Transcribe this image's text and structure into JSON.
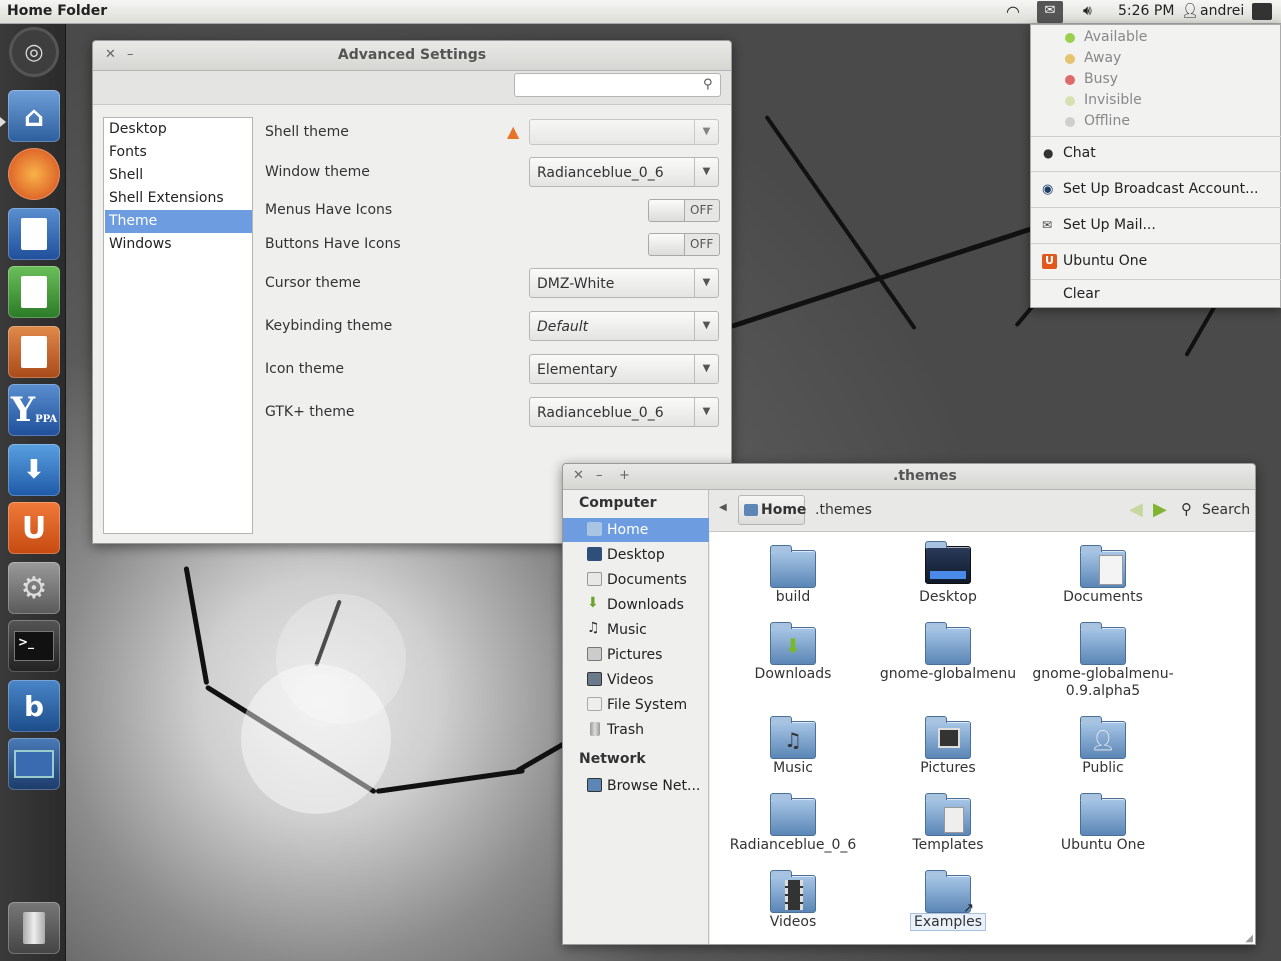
{
  "top_panel": {
    "title": "Home Folder",
    "time": "5:26 PM",
    "user": "andrei"
  },
  "message_menu": {
    "statuses": [
      {
        "label": "Available",
        "color": "#9ccf4e"
      },
      {
        "label": "Away",
        "color": "#e6c36e"
      },
      {
        "label": "Busy",
        "color": "#e06a6a"
      },
      {
        "label": "Invisible",
        "color": "#d6e0b0"
      },
      {
        "label": "Offline",
        "color": "#cfcfcf"
      }
    ],
    "chat": "Chat",
    "broadcast": "Set Up Broadcast Account...",
    "mail": "Set Up Mail...",
    "ubuntu_one": "Ubuntu One",
    "clear": "Clear"
  },
  "advanced_settings": {
    "title": "Advanced Settings",
    "search_placeholder": "",
    "categories": [
      "Desktop",
      "Fonts",
      "Shell",
      "Shell Extensions",
      "Theme",
      "Windows"
    ],
    "selected_category": "Theme",
    "rows": [
      {
        "label": "Shell theme",
        "value": ""
      },
      {
        "label": "Window theme",
        "value": "Radianceblue_0_6"
      },
      {
        "label": "Menus Have Icons",
        "toggle": "OFF"
      },
      {
        "label": "Buttons Have Icons",
        "toggle": "OFF"
      },
      {
        "label": "Cursor theme",
        "value": "DMZ-White"
      },
      {
        "label": "Keybinding theme",
        "value": "Default"
      },
      {
        "label": "Icon theme",
        "value": "Elementary"
      },
      {
        "label": "GTK+ theme",
        "value": "Radianceblue_0_6"
      }
    ]
  },
  "file_manager": {
    "title": ".themes",
    "path": [
      "Home",
      ".themes"
    ],
    "search_label": "Search",
    "sidebar": {
      "computer_header": "Computer",
      "computer_items": [
        "Home",
        "Desktop",
        "Documents",
        "Downloads",
        "Music",
        "Pictures",
        "Videos",
        "File System",
        "Trash"
      ],
      "network_header": "Network",
      "network_items": [
        "Browse Net..."
      ]
    },
    "files": [
      {
        "name": "build",
        "icon": "folder-icon"
      },
      {
        "name": "Desktop",
        "icon": "desktop-folder-icon"
      },
      {
        "name": "Documents",
        "icon": "documents-folder-icon"
      },
      {
        "name": "Downloads",
        "icon": "downloads-folder-icon"
      },
      {
        "name": "gnome-globalmenu",
        "icon": "folder-icon"
      },
      {
        "name": "gnome-globalmenu-\n0.9.alpha5",
        "icon": "folder-icon"
      },
      {
        "name": "Music",
        "icon": "music-folder-icon"
      },
      {
        "name": "Pictures",
        "icon": "pictures-folder-icon"
      },
      {
        "name": "Public",
        "icon": "public-folder-icon"
      },
      {
        "name": "Radianceblue_0_6",
        "icon": "folder-icon"
      },
      {
        "name": "Templates",
        "icon": "templates-folder-icon"
      },
      {
        "name": "Ubuntu One",
        "icon": "folder-icon"
      },
      {
        "name": "Videos",
        "icon": "videos-folder-icon"
      },
      {
        "name": "Examples",
        "icon": "examples-link-folder-icon"
      }
    ]
  },
  "launcher": {
    "items": [
      "ubuntu-logo-icon",
      "home-folder-icon",
      "firefox-icon",
      "writer-icon",
      "calc-icon",
      "impress-icon",
      "y-ppa-manager-icon",
      "software-center-icon",
      "ubuntu-one-icon",
      "system-settings-icon",
      "terminal-icon",
      "bleachbit-icon",
      "workspace-switcher-icon",
      "trash-icon"
    ],
    "yppa_text": "Y",
    "yppa_sub": "PPA"
  }
}
